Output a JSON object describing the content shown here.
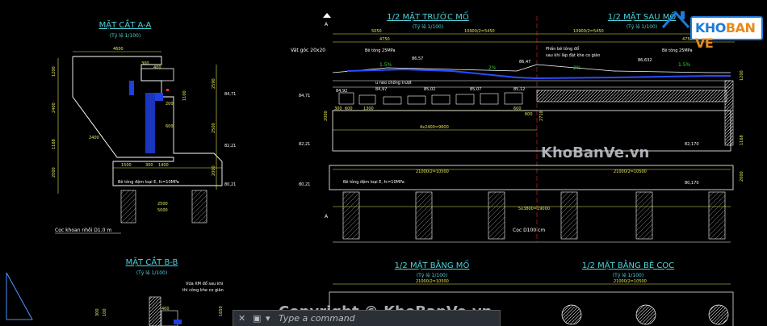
{
  "sections": {
    "section_aa": {
      "title": "MẶT CẮT A-A",
      "scale": "(Tỷ lệ 1/100)"
    },
    "section_bb": {
      "title": "MẶT CẮT B-B",
      "scale": "(Tỷ lệ 1/100)"
    },
    "front": {
      "title": "1/2 MẶT TRƯỚC MỐ",
      "scale": "(Tỷ lệ 1/100)"
    },
    "back": {
      "title": "1/2 MẶT SAU MỐ",
      "scale": "(Tỷ lệ 1/100)"
    },
    "plan": {
      "title": "1/2 MẶT BẰNG MỐ",
      "scale": "(Tỷ lệ 1/100)"
    },
    "pile_plan": {
      "title": "1/2 MẶT BẰNG BỆ CỌC",
      "scale": "(Tỷ lệ 1/100)"
    }
  },
  "dims": {
    "aa_top": "4600",
    "aa_300": "300",
    "aa_400": "400",
    "aa_200": "200",
    "aa_1200": "1200",
    "aa_2400": "2400",
    "aa_1168": "1168",
    "aa_2000": "2000",
    "aa_2590": "2590",
    "aa_1100": "1100",
    "aa_2500": "2500",
    "aa_2000b": "2000",
    "aa_1500": "1500",
    "aa_300b": "300",
    "aa_1400": "1400",
    "aa_2500b": "2500",
    "aa_5000": "5000",
    "aa_2400b": "2400",
    "aa_600": "600",
    "fr_5050": "5050",
    "fr_4750": "4750",
    "fr_10900": "10900/2=5450",
    "bk_10900": "10900/2=5450",
    "bk_4750": "4750",
    "fr_300": "300",
    "fr_600": "600",
    "fr_1300": "1300",
    "fr_4x2400": "4x2400=9600",
    "fr_21000": "21000/2=10500",
    "bk_21000": "21000/2=10500",
    "fr_5x3800": "5x3800=19000",
    "fr_600c": "600",
    "fr_600d": "600",
    "fr_2000": "2000",
    "fr_2710": "2710",
    "pl_21000": "21000/2=10500",
    "pl_21000b": "21000/2=10500",
    "bk_1168": "1168",
    "bk_1200": "1200",
    "bk_2000": "2000",
    "bk_2590": "2590"
  },
  "levels": {
    "l1": "84,71",
    "l2": "82,21",
    "l3": "80,21",
    "f1": "86,57",
    "f2": "86,47",
    "f3": "84,92",
    "f4": "84,97",
    "f5": "85,07",
    "f6": "85,12",
    "f7": "85,02",
    "f8": "84,71",
    "f9": "82,21",
    "f10": "80,21",
    "b1": "86,632",
    "b2": "82,170",
    "b3": "80,170"
  },
  "notes": {
    "be_tong_dem_aa": "Bê tông đệm loại E, fc=10MPa",
    "coc_aa": "Cọc khoan nhồi D1.0 m",
    "vat_goc": "Vát góc 20x20",
    "be_tong_25": "Bê tông 25MPa",
    "be_tong_25b": "Bê tông 25MPa",
    "phan_be_tong": "Phần bê tông đổ",
    "sau_khi_lap": "sau khi lắp đặt khe co giãn",
    "u_neo": "u neo chống trượt",
    "be_tong_dem_front": "Bê tông đệm loại E, fc=10MPa",
    "coc_front": "Cọc D100 cm",
    "slope_left": "1.5%",
    "slope_2a": "2%",
    "slope_2b": "2%",
    "slope_right": "1.5%",
    "vua_xm": "Vữa XM đổ sau khi",
    "thi_cong": "thi công khe co giãn",
    "marker_a_top": "A",
    "marker_a_bot": "A",
    "bb_300": "300",
    "bb_400": "400",
    "bb_100": "100",
    "bb_1650": "1650"
  },
  "watermarks": {
    "mid": "KhoBanVe.vn",
    "bottom": "Copyright © KhoBanVe.vn",
    "logo_part1": "KHO",
    "logo_part2": "BAN VE"
  },
  "command_bar": {
    "close": "✕",
    "icon": "▣",
    "arrow": "▾",
    "prompt": "Type a command"
  },
  "colors": {
    "line": "#ffffff",
    "title": "#4fd1d9",
    "dim": "#e8e85a",
    "cut": "#2a4cff",
    "green": "#33d233",
    "red": "#ff3b3b",
    "watermark": "#c8ccd2",
    "background": "#000000"
  }
}
